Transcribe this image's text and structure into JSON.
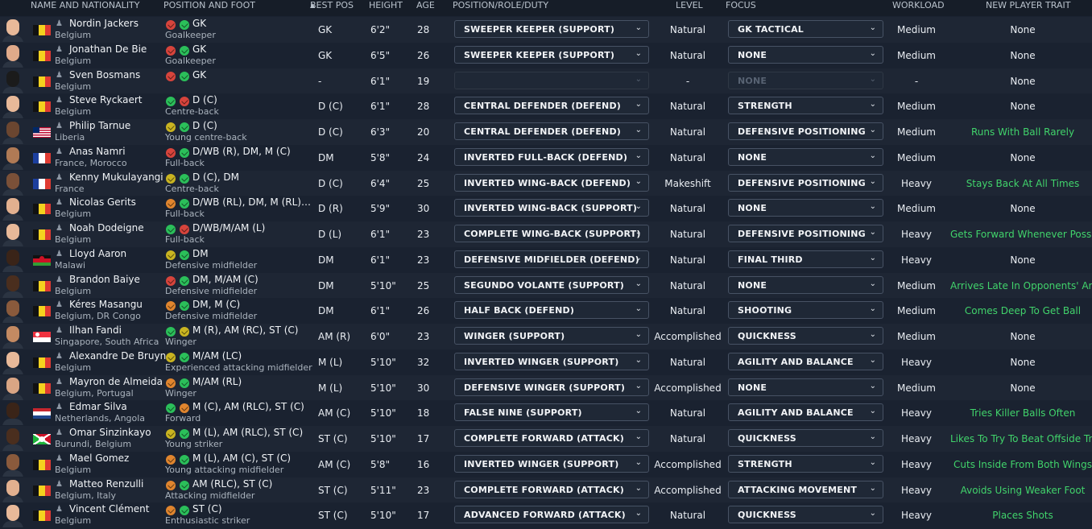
{
  "columns": {
    "name": "NAME AND NATIONALITY",
    "position": "POSITION AND FOOT",
    "best_pos": "BEST POS",
    "height": "HEIGHT",
    "age": "AGE",
    "role": "POSITION/ROLE/DUTY",
    "level": "LEVEL",
    "focus": "FOCUS",
    "workload": "WORKLOAD",
    "trait": "NEW PLAYER TRAIT",
    "sort_icon": "sort-arrow-up-icon"
  },
  "colors": {
    "green": "#2bbf5a",
    "red": "#d7443c",
    "orange": "#e0852e",
    "yellow": "#c9b421",
    "trait_green": "#41d36b"
  },
  "rows": [
    {
      "name": "Nordin Jackers",
      "nat": "Belgium",
      "flag": "BE",
      "skin": "#e8b999",
      "dots": [
        "red",
        "green"
      ],
      "pos": "GK",
      "foot": "Goalkeeper",
      "best": "GK",
      "height": "6'2\"",
      "age": "28",
      "role": "SWEEPER KEEPER (SUPPORT)",
      "level": "Natural",
      "focus": "GK TACTICAL",
      "workload": "Medium",
      "trait": "None",
      "trait_green": false,
      "disabled": false
    },
    {
      "name": "Jonathan De Bie",
      "nat": "Belgium",
      "flag": "BE",
      "skin": "#e0aa8a",
      "dots": [
        "red",
        "green"
      ],
      "pos": "GK",
      "foot": "Goalkeeper",
      "best": "GK",
      "height": "6'5\"",
      "age": "26",
      "role": "SWEEPER KEEPER (SUPPORT)",
      "level": "Natural",
      "focus": "NONE",
      "workload": "Medium",
      "trait": "None",
      "trait_green": false,
      "disabled": false
    },
    {
      "name": "Sven Bosmans",
      "nat": "Belgium",
      "flag": "BE",
      "skin": "#1b1b1b",
      "dots": [
        "red",
        "green"
      ],
      "pos": "GK",
      "foot": "",
      "best": "-",
      "height": "6'1\"",
      "age": "19",
      "role": "",
      "level": "-",
      "focus": "NONE",
      "workload": "-",
      "trait": "None",
      "trait_green": false,
      "disabled": true
    },
    {
      "name": "Steve Ryckaert",
      "nat": "Belgium",
      "flag": "BE",
      "skin": "#e8b999",
      "dots": [
        "green",
        "red"
      ],
      "pos": "D (C)",
      "foot": "Centre-back",
      "best": "D (C)",
      "height": "6'1\"",
      "age": "28",
      "role": "CENTRAL DEFENDER (DEFEND)",
      "level": "Natural",
      "focus": "STRENGTH",
      "workload": "Medium",
      "trait": "None",
      "trait_green": false,
      "disabled": false
    },
    {
      "name": "Philip Tarnue",
      "nat": "Liberia",
      "flag": "LR",
      "skin": "#6b4630",
      "dots": [
        "yellow",
        "green"
      ],
      "pos": "D (C)",
      "foot": "Young centre-back",
      "best": "D (C)",
      "height": "6'3\"",
      "age": "20",
      "role": "CENTRAL DEFENDER (DEFEND)",
      "level": "Natural",
      "focus": "DEFENSIVE POSITIONING",
      "workload": "Medium",
      "trait": "Runs With Ball Rarely",
      "trait_green": true,
      "disabled": false
    },
    {
      "name": "Anas Namri",
      "nat": "France, Morocco",
      "flag": "FR",
      "skin": "#b07a55",
      "dots": [
        "red",
        "green"
      ],
      "pos": "D/WB (R), DM, M (C)",
      "foot": "Full-back",
      "best": "DM",
      "height": "5'8\"",
      "age": "24",
      "role": "INVERTED FULL-BACK (DEFEND)",
      "level": "Natural",
      "focus": "NONE",
      "workload": "Medium",
      "trait": "None",
      "trait_green": false,
      "disabled": false
    },
    {
      "name": "Kenny Mukulayangi",
      "nat": "France",
      "flag": "FR",
      "skin": "#7a5038",
      "dots": [
        "yellow",
        "green"
      ],
      "pos": "D (C), DM",
      "foot": "Centre-back",
      "best": "D (C)",
      "height": "6'4\"",
      "age": "25",
      "role": "INVERTED WING-BACK (DEFEND)",
      "level": "Makeshift",
      "focus": "DEFENSIVE POSITIONING",
      "workload": "Heavy",
      "trait": "Stays Back At All Times",
      "trait_green": true,
      "disabled": false
    },
    {
      "name": "Nicolas Gerits",
      "nat": "Belgium",
      "flag": "BE",
      "skin": "#e2b08f",
      "dots": [
        "orange",
        "green"
      ],
      "pos": "D/WB (RL), DM, M (RL), AM (RL)",
      "foot": "Full-back",
      "best": "D (R)",
      "height": "5'9\"",
      "age": "30",
      "role": "INVERTED WING-BACK (SUPPORT)",
      "level": "Natural",
      "focus": "NONE",
      "workload": "Medium",
      "trait": "None",
      "trait_green": false,
      "disabled": false
    },
    {
      "name": "Noah Dodeigne",
      "nat": "Belgium",
      "flag": "BE",
      "skin": "#e8b999",
      "dots": [
        "green",
        "red"
      ],
      "pos": "D/WB/M/AM (L)",
      "foot": "Full-back",
      "best": "D (L)",
      "height": "6'1\"",
      "age": "23",
      "role": "COMPLETE WING-BACK (SUPPORT)",
      "level": "Natural",
      "focus": "DEFENSIVE POSITIONING",
      "workload": "Heavy",
      "trait": "Gets Forward Whenever Possible",
      "trait_green": true,
      "disabled": false
    },
    {
      "name": "Lloyd Aaron",
      "nat": "Malawi",
      "flag": "MW",
      "skin": "#3a2418",
      "dots": [
        "yellow",
        "green"
      ],
      "pos": "DM",
      "foot": "Defensive midfielder",
      "best": "DM",
      "height": "6'1\"",
      "age": "23",
      "role": "DEFENSIVE MIDFIELDER (DEFEND)",
      "level": "Natural",
      "focus": "FINAL THIRD",
      "workload": "Heavy",
      "trait": "None",
      "trait_green": false,
      "disabled": false
    },
    {
      "name": "Brandon Baiye",
      "nat": "Belgium",
      "flag": "BE",
      "skin": "#4a2e1e",
      "dots": [
        "red",
        "green"
      ],
      "pos": "DM, M/AM (C)",
      "foot": "Defensive midfielder",
      "best": "DM",
      "height": "5'10\"",
      "age": "25",
      "role": "SEGUNDO VOLANTE (SUPPORT)",
      "level": "Natural",
      "focus": "NONE",
      "workload": "Medium",
      "trait": "Arrives Late In Opponents' Area",
      "trait_green": true,
      "disabled": false
    },
    {
      "name": "Kéres Masangu",
      "nat": "Belgium, DR Congo",
      "flag": "BE",
      "skin": "#8a5a3c",
      "dots": [
        "orange",
        "green"
      ],
      "pos": "DM, M (C)",
      "foot": "Defensive midfielder",
      "best": "DM",
      "height": "6'1\"",
      "age": "26",
      "role": "HALF BACK (DEFEND)",
      "level": "Natural",
      "focus": "SHOOTING",
      "workload": "Medium",
      "trait": "Comes Deep To Get Ball",
      "trait_green": true,
      "disabled": false
    },
    {
      "name": "Ilhan Fandi",
      "nat": "Singapore, South Africa",
      "flag": "SG",
      "skin": "#c48a62",
      "dots": [
        "green",
        "yellow"
      ],
      "pos": "M (R), AM (RC), ST (C)",
      "foot": "Winger",
      "best": "AM (R)",
      "height": "6'0\"",
      "age": "23",
      "role": "WINGER (SUPPORT)",
      "level": "Accomplished",
      "focus": "QUICKNESS",
      "workload": "Medium",
      "trait": "None",
      "trait_green": false,
      "disabled": false
    },
    {
      "name": "Alexandre De Bruyn",
      "nat": "Belgium",
      "flag": "BE",
      "skin": "#e8b999",
      "dots": [
        "yellow",
        "green"
      ],
      "pos": "M/AM (LC)",
      "foot": "Experienced attacking midfielder",
      "best": "M (L)",
      "height": "5'10\"",
      "age": "32",
      "role": "INVERTED WINGER (SUPPORT)",
      "level": "Natural",
      "focus": "AGILITY AND BALANCE",
      "workload": "Heavy",
      "trait": "None",
      "trait_green": false,
      "disabled": false
    },
    {
      "name": "Mayron de Almeida",
      "nat": "Belgium, Portugal",
      "flag": "BE",
      "skin": "#d9a584",
      "dots": [
        "orange",
        "green"
      ],
      "pos": "M/AM (RL)",
      "foot": "Winger",
      "best": "M (L)",
      "height": "5'10\"",
      "age": "30",
      "role": "DEFENSIVE WINGER (SUPPORT)",
      "level": "Accomplished",
      "focus": "NONE",
      "workload": "Medium",
      "trait": "None",
      "trait_green": false,
      "disabled": false
    },
    {
      "name": "Edmar Silva",
      "nat": "Netherlands, Angola",
      "flag": "NL",
      "skin": "#3a2418",
      "dots": [
        "green",
        "orange"
      ],
      "pos": "M (C), AM (RLC), ST (C)",
      "foot": "Forward",
      "best": "AM (C)",
      "height": "5'10\"",
      "age": "18",
      "role": "FALSE NINE (SUPPORT)",
      "level": "Natural",
      "focus": "AGILITY AND BALANCE",
      "workload": "Heavy",
      "trait": "Tries Killer Balls Often",
      "trait_green": true,
      "disabled": false
    },
    {
      "name": "Omar Sinzinkayo",
      "nat": "Burundi, Belgium",
      "flag": "BI",
      "skin": "#4a2e1e",
      "dots": [
        "yellow",
        "green"
      ],
      "pos": "M (L), AM (RLC), ST (C)",
      "foot": "Young striker",
      "best": "ST (C)",
      "height": "5'10\"",
      "age": "17",
      "role": "COMPLETE FORWARD (ATTACK)",
      "level": "Natural",
      "focus": "QUICKNESS",
      "workload": "Heavy",
      "trait": "Likes To Try To Beat Offside Trap",
      "trait_green": true,
      "disabled": false
    },
    {
      "name": "Mael Gomez",
      "nat": "Belgium",
      "flag": "BE",
      "skin": "#8a5a3c",
      "dots": [
        "orange",
        "green"
      ],
      "pos": "M (L), AM (C), ST (C)",
      "foot": "Young attacking midfielder",
      "best": "AM (C)",
      "height": "5'8\"",
      "age": "16",
      "role": "INVERTED WINGER (SUPPORT)",
      "level": "Accomplished",
      "focus": "STRENGTH",
      "workload": "Heavy",
      "trait": "Cuts Inside From Both Wings",
      "trait_green": true,
      "disabled": false
    },
    {
      "name": "Matteo Renzulli",
      "nat": "Belgium, Italy",
      "flag": "BE",
      "skin": "#e2b08f",
      "dots": [
        "orange",
        "green"
      ],
      "pos": "AM (RLC), ST (C)",
      "foot": "Attacking midfielder",
      "best": "ST (C)",
      "height": "5'11\"",
      "age": "23",
      "role": "COMPLETE FORWARD (ATTACK)",
      "level": "Accomplished",
      "focus": "ATTACKING MOVEMENT",
      "workload": "Heavy",
      "trait": "Avoids Using Weaker Foot",
      "trait_green": true,
      "disabled": false
    },
    {
      "name": "Vincent Clément",
      "nat": "Belgium",
      "flag": "BE",
      "skin": "#e8b999",
      "dots": [
        "orange",
        "green"
      ],
      "pos": "ST (C)",
      "foot": "Enthusiastic striker",
      "best": "ST (C)",
      "height": "5'10\"",
      "age": "17",
      "role": "ADVANCED FORWARD (ATTACK)",
      "level": "Natural",
      "focus": "QUICKNESS",
      "workload": "Heavy",
      "trait": "Places Shots",
      "trait_green": true,
      "disabled": false
    }
  ]
}
